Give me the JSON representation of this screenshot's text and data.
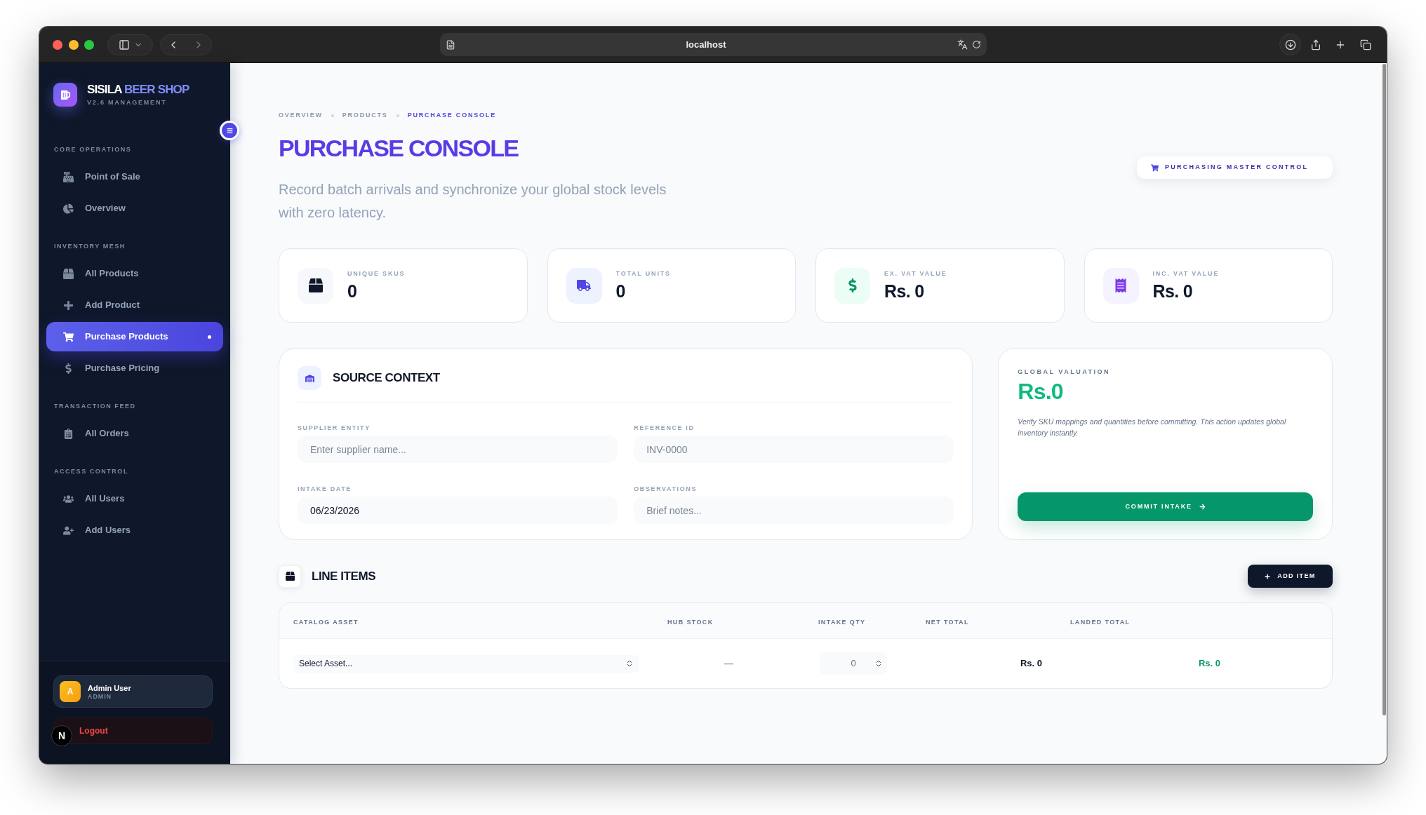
{
  "browser": {
    "url": "localhost"
  },
  "sidebar": {
    "brand": {
      "name": "SISILA",
      "accent": "BEER SHOP",
      "version": "V2.6 MANAGEMENT"
    },
    "sections": [
      {
        "title": "CORE OPERATIONS",
        "items": [
          {
            "label": "Point of Sale",
            "selected": false
          },
          {
            "label": "Overview",
            "selected": false
          }
        ]
      },
      {
        "title": "INVENTORY MESH",
        "items": [
          {
            "label": "All Products",
            "selected": false
          },
          {
            "label": "Add Product",
            "selected": false
          },
          {
            "label": "Purchase Products",
            "selected": true
          },
          {
            "label": "Purchase Pricing",
            "selected": false
          }
        ]
      },
      {
        "title": "TRANSACTION FEED",
        "items": [
          {
            "label": "All Orders",
            "selected": false
          }
        ]
      },
      {
        "title": "ACCESS CONTROL",
        "items": [
          {
            "label": "All Users",
            "selected": false
          },
          {
            "label": "Add Users",
            "selected": false
          }
        ]
      }
    ],
    "user": {
      "initial": "A",
      "name": "Admin User",
      "role": "ADMIN"
    },
    "logout": "Logout"
  },
  "dev_badge": "N",
  "breadcrumb": [
    {
      "label": "OVERVIEW",
      "selected": false
    },
    {
      "label": "PRODUCTS",
      "selected": false
    },
    {
      "label": "PURCHASE CONSOLE",
      "selected": true
    }
  ],
  "header": {
    "title": "PURCHASE CONSOLE",
    "subtitle": "Record batch arrivals and synchronize your global stock levels with zero latency.",
    "badge": "PURCHASING MASTER CONTROL"
  },
  "stats": [
    {
      "label": "UNIQUE SKUS",
      "value": "0"
    },
    {
      "label": "TOTAL UNITS",
      "value": "0"
    },
    {
      "label": "EX. VAT VALUE",
      "value": "Rs. 0"
    },
    {
      "label": "INC. VAT VALUE",
      "value": "Rs. 0"
    }
  ],
  "source_context": {
    "title": "SOURCE CONTEXT",
    "fields": [
      {
        "label": "SUPPLIER ENTITY",
        "placeholder": "Enter supplier name..."
      },
      {
        "label": "REFERENCE ID",
        "placeholder": "INV-0000"
      },
      {
        "label": "INTAKE DATE",
        "value": "06/23/2026"
      },
      {
        "label": "OBSERVATIONS",
        "placeholder": "Brief notes..."
      }
    ]
  },
  "valuation": {
    "label": "GLOBAL VALUATION",
    "value": "Rs.0",
    "note": "Verify SKU mappings and quantities before committing. This action updates global inventory instantly.",
    "button": "COMMIT INTAKE"
  },
  "line_items": {
    "title": "LINE ITEMS",
    "add_button": "ADD ITEM",
    "columns": [
      "CATALOG ASSET",
      "HUB STOCK",
      "INTAKE QTY",
      "NET TOTAL",
      "LANDED TOTAL"
    ],
    "rows": [
      {
        "asset": "Select Asset...",
        "hub_stock": "—",
        "qty": "0",
        "net_total": "Rs. 0",
        "landed_total": "Rs. 0"
      }
    ]
  }
}
